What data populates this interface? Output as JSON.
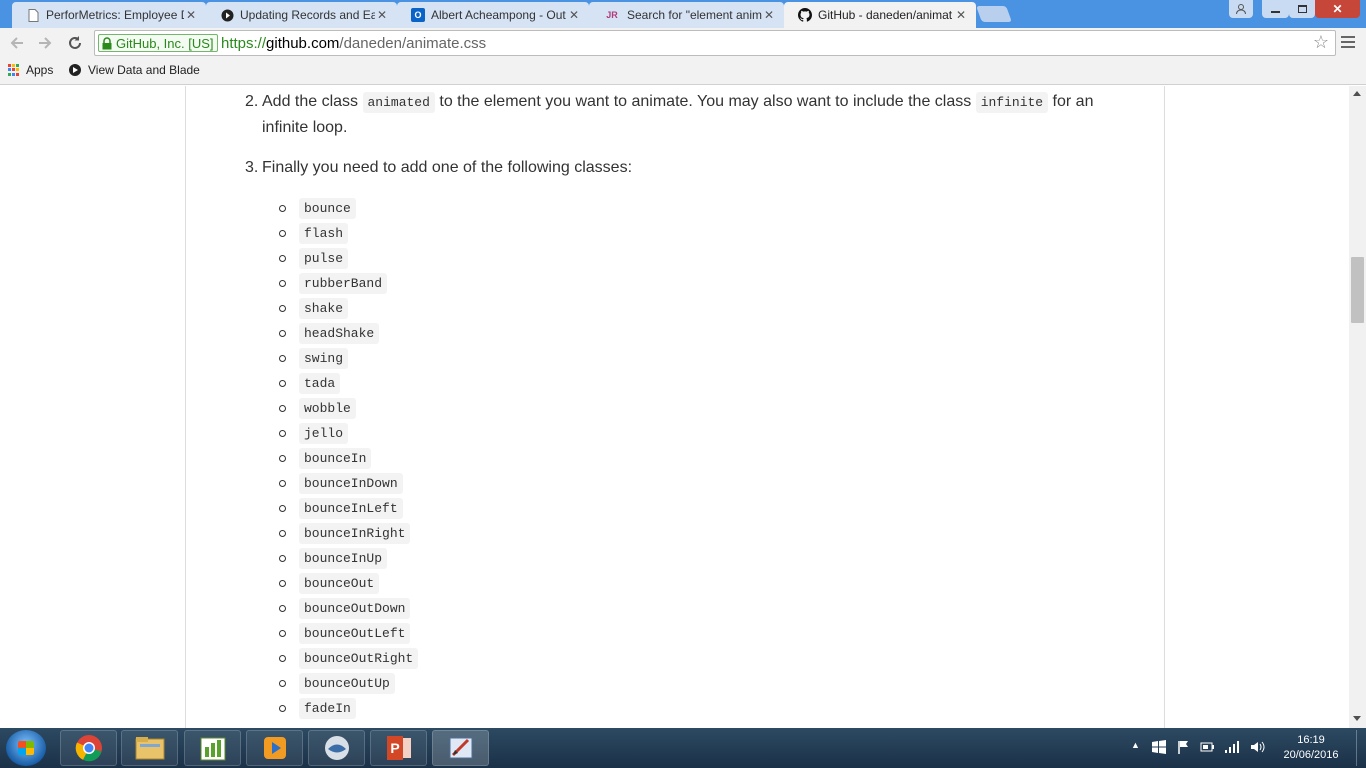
{
  "browser": {
    "tabs": [
      {
        "title": "PerforMetrics: Employee D",
        "icon": "document-icon"
      },
      {
        "title": "Updating Records and Ea",
        "icon": "video-icon"
      },
      {
        "title": "Albert Acheampong - Out",
        "icon": "outlook-icon"
      },
      {
        "title": "Search for \"element anim",
        "icon": "jira-icon",
        "icon_text": "JR"
      },
      {
        "title": "GitHub - daneden/animat",
        "icon": "github-icon",
        "active": true
      }
    ],
    "security_label": "GitHub, Inc. [US]",
    "url_scheme": "https://",
    "url_host": "github.com",
    "url_path": "/daneden/animate.css",
    "bookmarks": [
      {
        "label": "Apps",
        "icon": "apps-grid-icon"
      },
      {
        "label": "View Data and Blade",
        "icon": "play-circle-icon"
      }
    ]
  },
  "readme": {
    "step2": {
      "number": "2.",
      "before": "Add the class ",
      "code1": "animated",
      "middle": " to the element you want to animate. You may also want to include the class ",
      "code2": "infinite",
      "after": " for an infinite loop."
    },
    "step3": {
      "number": "3.",
      "text": "Finally you need to add one of the following classes:"
    },
    "classes": [
      "bounce",
      "flash",
      "pulse",
      "rubberBand",
      "shake",
      "headShake",
      "swing",
      "tada",
      "wobble",
      "jello",
      "bounceIn",
      "bounceInDown",
      "bounceInLeft",
      "bounceInRight",
      "bounceInUp",
      "bounceOut",
      "bounceOutDown",
      "bounceOutLeft",
      "bounceOutRight",
      "bounceOutUp",
      "fadeIn"
    ]
  },
  "taskbar": {
    "apps": [
      "chrome-icon",
      "file-explorer-icon",
      "chart-app-icon",
      "media-player-icon",
      "thunderbird-icon",
      "powerpoint-icon",
      "paint-tool-icon"
    ],
    "time": "16:19",
    "date": "20/06/2016"
  },
  "colors": {
    "tabstrip": "#4a93e3",
    "secure_green": "#2a8a1c",
    "taskbar": "#1b3148"
  }
}
